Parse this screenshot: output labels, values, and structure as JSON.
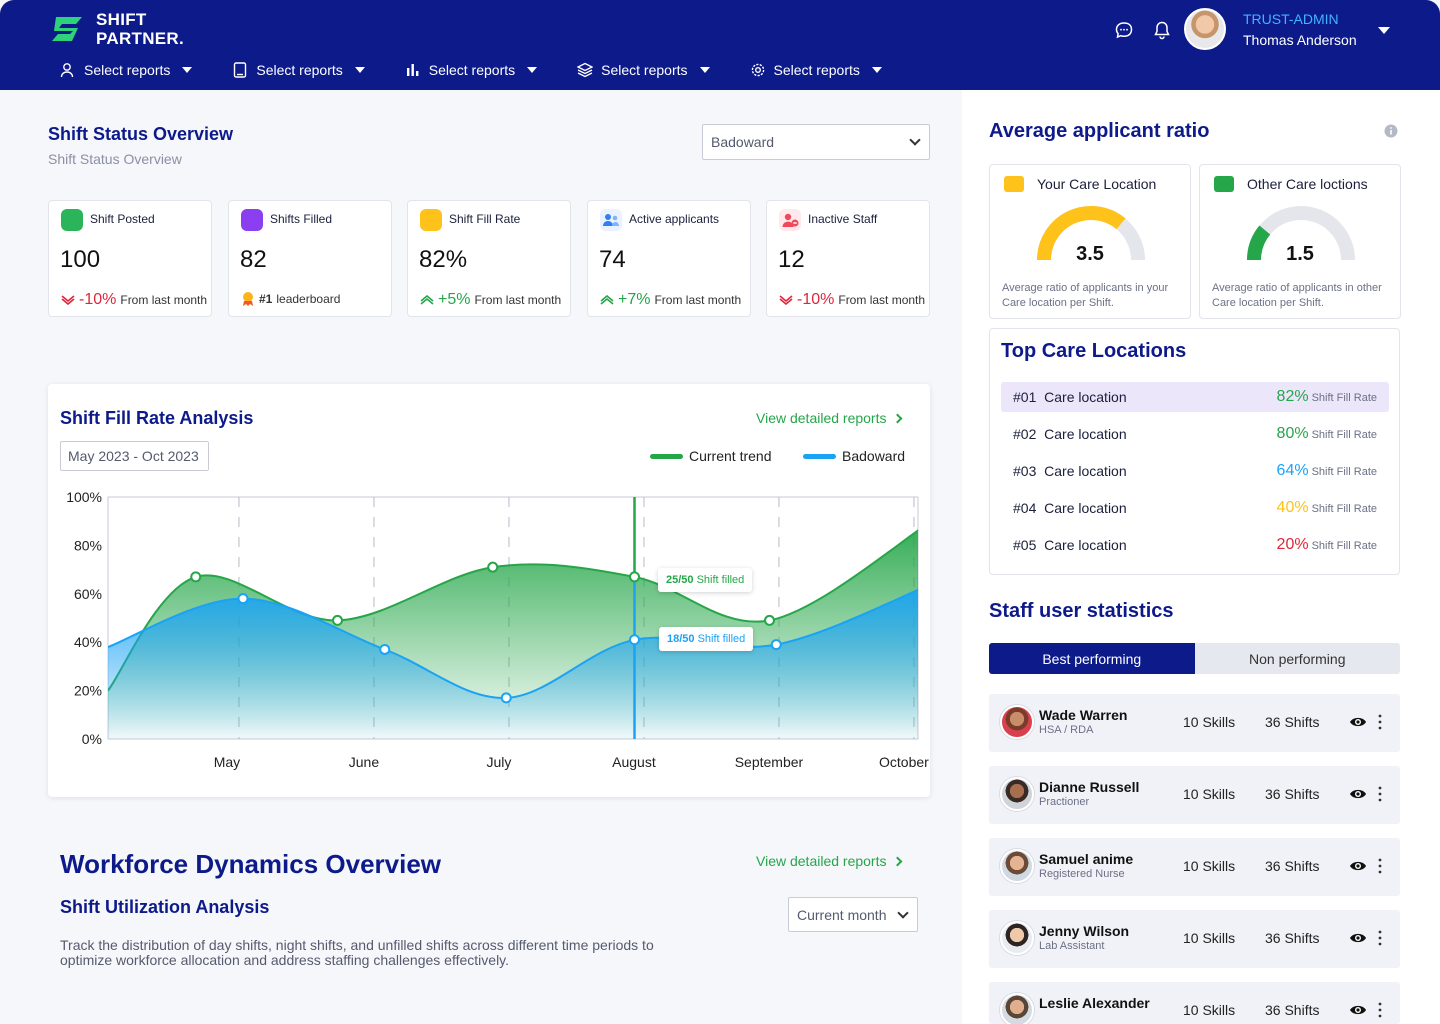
{
  "header": {
    "brand_line1": "SHIFT",
    "brand_line2": "PARTNER.",
    "nav": [
      {
        "label": "Select reports",
        "icon": "user-icon"
      },
      {
        "label": "Select reports",
        "icon": "tablet-icon"
      },
      {
        "label": "Select reports",
        "icon": "bar-chart-icon"
      },
      {
        "label": "Select reports",
        "icon": "layers-icon"
      },
      {
        "label": "Select reports",
        "icon": "gear-icon"
      }
    ],
    "user_role": "TRUST-ADMIN",
    "user_name": "Thomas Anderson"
  },
  "overview": {
    "title": "Shift Status Overview",
    "subtitle": "Shift Status Overview",
    "ward_select": "Badoward",
    "stats": [
      {
        "label": "Shift Posted",
        "value": "100",
        "delta": "-10%",
        "foot": "From last month",
        "trend": "down",
        "icon": "shift-posted-icon",
        "color": "#2bb55a"
      },
      {
        "label": "Shifts Filled",
        "value": "82",
        "delta": "#1",
        "foot": "leaderboard",
        "trend": "rank",
        "icon": "shifts-filled-icon",
        "color": "#8b3ff0"
      },
      {
        "label": "Shift Fill Rate",
        "value": "82%",
        "delta": "+5%",
        "foot": "From last month",
        "trend": "up",
        "icon": "fill-rate-icon",
        "color": "#ffc21a"
      },
      {
        "label": "Active applicants",
        "value": "74",
        "delta": "+7%",
        "foot": "From last month",
        "trend": "up",
        "icon": "applicants-icon",
        "color": "#2f7ff0"
      },
      {
        "label": "Inactive Staff",
        "value": "12",
        "delta": "-10%",
        "foot": "From last month",
        "trend": "down",
        "icon": "inactive-staff-icon",
        "color": "#f04a5a"
      }
    ]
  },
  "fill_rate": {
    "title": "Shift Fill Rate Analysis",
    "view_link": "View  detailed reports",
    "date_range": "May 2023 - Oct 2023",
    "tooltip_green_count": "25/50",
    "tooltip_blue_count": "18/50",
    "tooltip_suffix": "Shift filled"
  },
  "chart_data": {
    "type": "area",
    "x": [
      "May",
      "June",
      "July",
      "August",
      "September",
      "October"
    ],
    "ylim": [
      0,
      100
    ],
    "yticks": [
      "100%",
      "80%",
      "60%",
      "40%",
      "20%",
      "0%"
    ],
    "series": [
      {
        "name": "Current trend",
        "color": "#25a649",
        "points": [
          [
            0,
            20
          ],
          [
            0.65,
            67
          ],
          [
            1.7,
            49
          ],
          [
            2.85,
            71
          ],
          [
            3.9,
            67
          ],
          [
            4.9,
            49
          ],
          [
            6.1,
            90
          ]
        ],
        "markers": [
          [
            0.65,
            67
          ],
          [
            1.7,
            49
          ],
          [
            2.85,
            71
          ],
          [
            3.9,
            67
          ],
          [
            4.9,
            49
          ]
        ]
      },
      {
        "name": "Badoward",
        "color": "#1aa3f5",
        "points": [
          [
            0,
            38
          ],
          [
            1.0,
            58
          ],
          [
            2.05,
            37
          ],
          [
            2.95,
            17
          ],
          [
            3.9,
            41
          ],
          [
            4.95,
            39
          ],
          [
            6.1,
            64
          ]
        ],
        "markers": [
          [
            1.0,
            58
          ],
          [
            2.05,
            37
          ],
          [
            2.95,
            17
          ],
          [
            3.9,
            41
          ],
          [
            4.95,
            39
          ]
        ]
      }
    ],
    "highlight_x": 3.9,
    "grid": true,
    "legend": "top-right"
  },
  "workforce": {
    "title": "Workforce Dynamics Overview",
    "view_link": "View  detailed reports",
    "subtitle": "Shift Utilization Analysis",
    "period_select": "Current month",
    "description": "Track the distribution of day shifts, night shifts, and unfilled shifts across different time periods to optimize workforce allocation and address staffing challenges effectively."
  },
  "applicant_ratio": {
    "title": "Average applicant ratio",
    "cards": [
      {
        "title": "Your Care Location",
        "value": "3.5",
        "desc": "Average ratio of applicants in your Care location per Shift.",
        "fraction": 0.72,
        "color": "#ffc21a"
      },
      {
        "title": "Other Care loctions",
        "value": "1.5",
        "desc": "Average ratio of applicants in other Care location per Shift.",
        "fraction": 0.22,
        "color": "#25a649"
      }
    ]
  },
  "top_locations": {
    "title": "Top Care Locations",
    "rate_label": "Shift Fill Rate",
    "items": [
      {
        "rank": "#01",
        "name": "Care location",
        "rate": "82%",
        "color": "#25a649"
      },
      {
        "rank": "#02",
        "name": "Care location",
        "rate": "80%",
        "color": "#25a649"
      },
      {
        "rank": "#03",
        "name": "Care location",
        "rate": "64%",
        "color": "#1aa3f5"
      },
      {
        "rank": "#04",
        "name": "Care location",
        "rate": "40%",
        "color": "#ffc21a"
      },
      {
        "rank": "#05",
        "name": "Care location",
        "rate": "20%",
        "color": "#e0263a"
      }
    ]
  },
  "staff": {
    "title": "Staff user statistics",
    "tab_best": "Best performing",
    "tab_non": "Non performing",
    "rows": [
      {
        "name": "Wade Warren",
        "role": "HSA / RDA",
        "skills": "10 Skills",
        "shifts": "36 Shifts"
      },
      {
        "name": "Dianne Russell",
        "role": "Practioner",
        "skills": "10 Skills",
        "shifts": "36 Shifts"
      },
      {
        "name": "Samuel anime",
        "role": "Registered Nurse",
        "skills": "10 Skills",
        "shifts": "36 Shifts"
      },
      {
        "name": "Jenny Wilson",
        "role": "Lab Assistant",
        "skills": "10 Skills",
        "shifts": "36 Shifts"
      },
      {
        "name": "Leslie Alexander",
        "role": "",
        "skills": "10 Skills",
        "shifts": "36 Shifts"
      }
    ]
  }
}
